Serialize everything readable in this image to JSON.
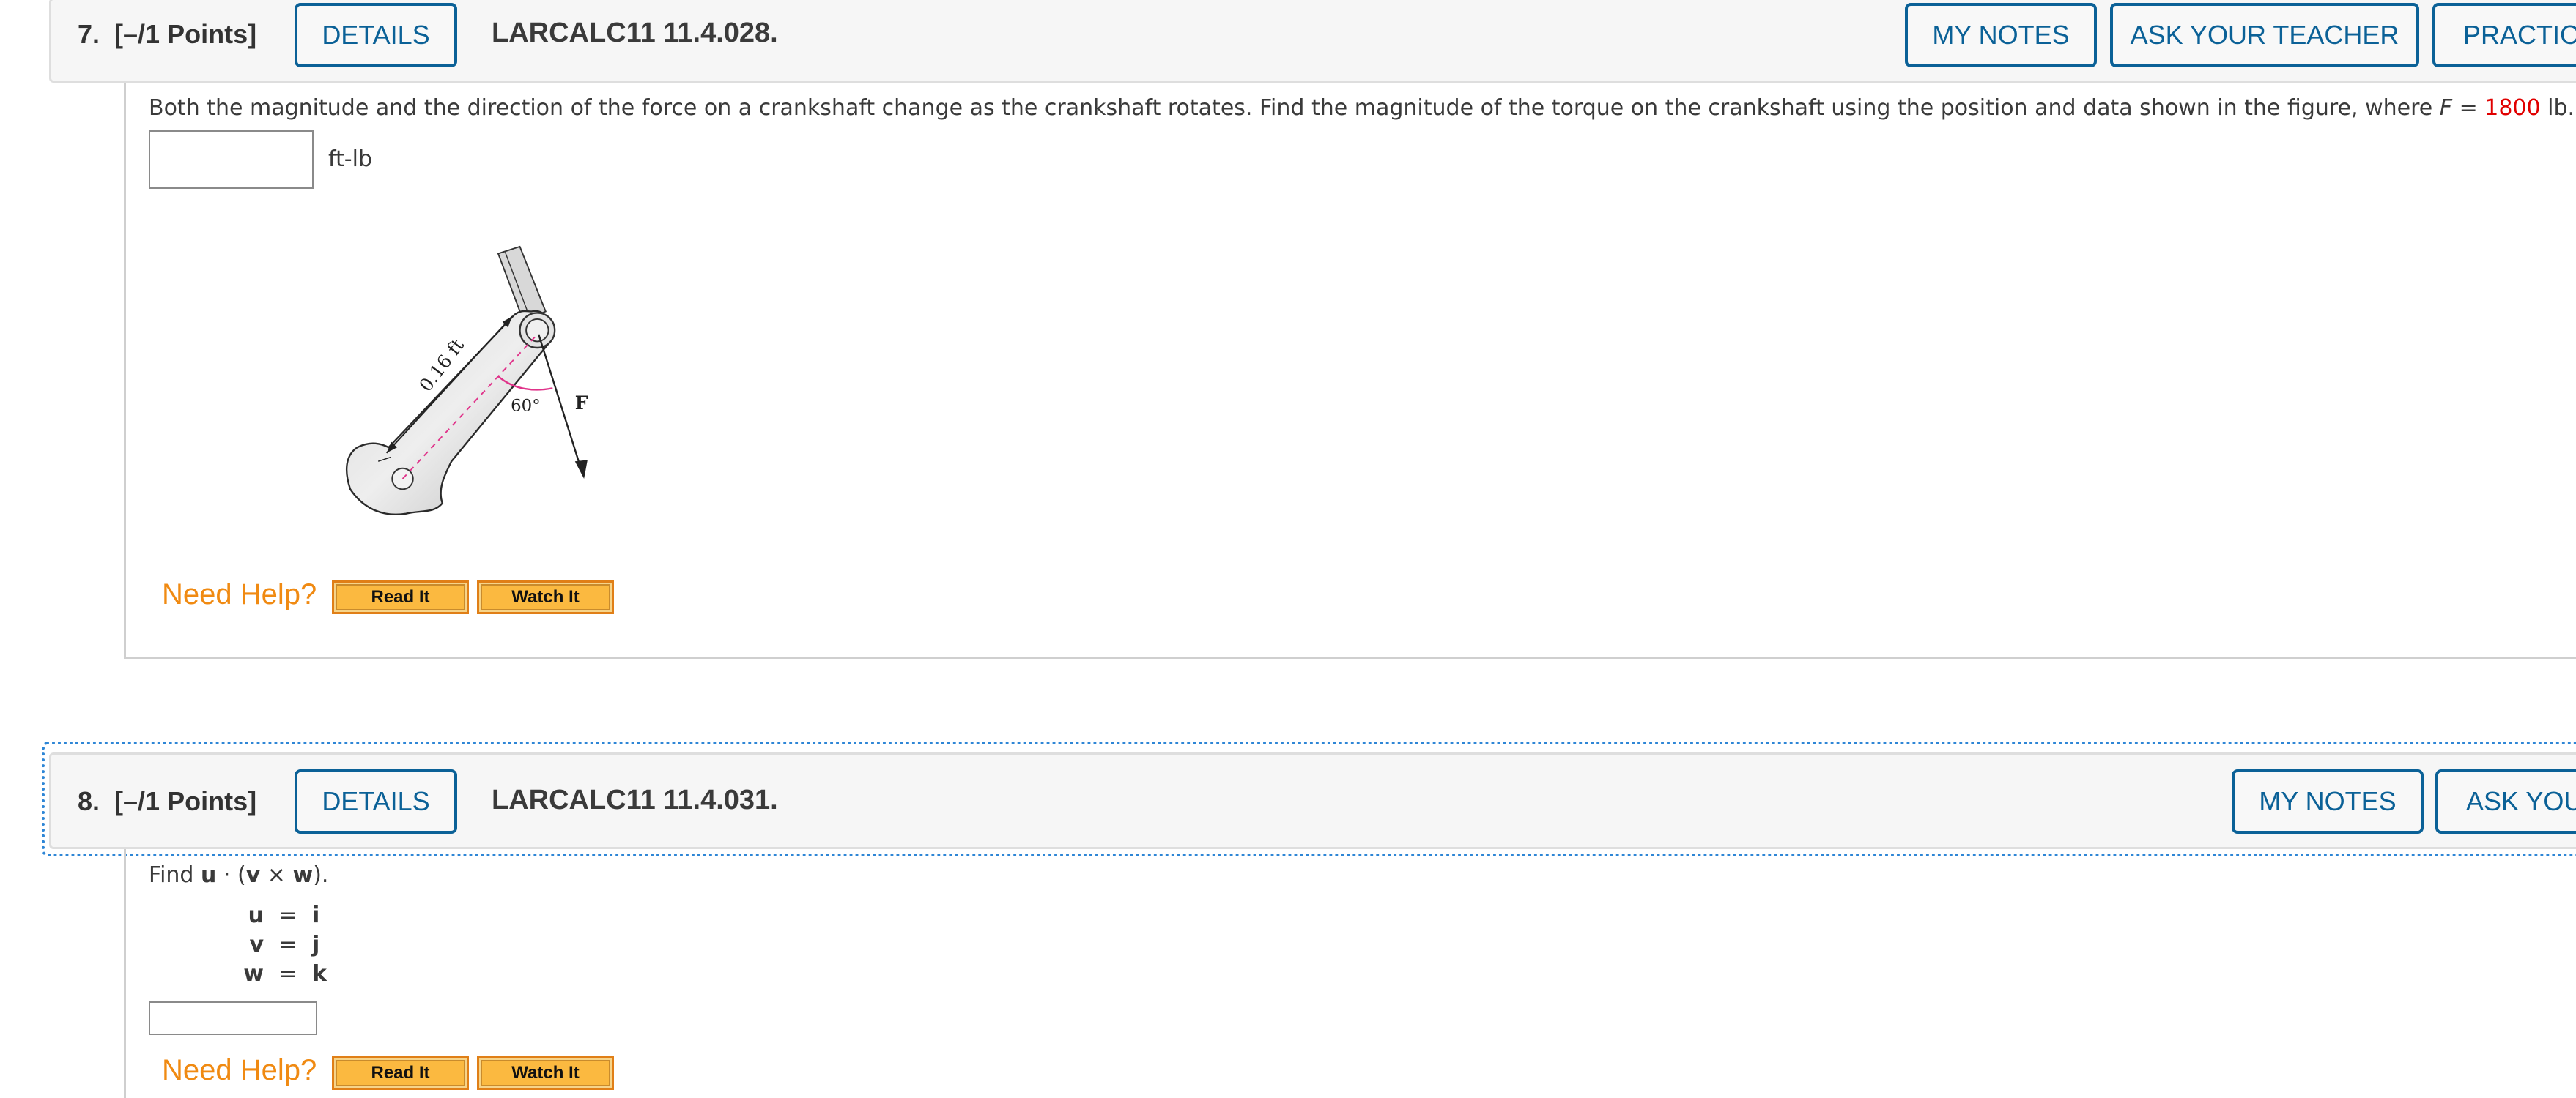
{
  "questions": [
    {
      "number": "7.",
      "points": "[–/1 Points]",
      "details_label": "DETAILS",
      "problem_id": "LARCALC11 11.4.028.",
      "buttons": [
        "MY NOTES",
        "ASK YOUR TEACHER",
        "PRACTICE"
      ],
      "prompt_before": "Both the magnitude and the direction of the force on a crankshaft change as the crankshaft rotates. Find the magnitude of the torque on the crankshaft using the position and data shown in the figure, where ",
      "prompt_var": "F",
      "prompt_eq": " = ",
      "prompt_value": "1800",
      "prompt_after": " lb.",
      "answer_value": "",
      "answer_unit": "ft-lb",
      "figure": {
        "length_label": "0.16 ft",
        "angle_label": "60°",
        "force_label": "F"
      },
      "need_help": "Need Help?",
      "help_buttons": [
        "Read It",
        "Watch It"
      ]
    },
    {
      "number": "8.",
      "points": "[–/1 Points]",
      "details_label": "DETAILS",
      "problem_id": "LARCALC11 11.4.031.",
      "buttons": [
        "MY NOTES",
        "ASK YOUR TEACHER"
      ],
      "prompt_find": "Find ",
      "prompt_expr": [
        "u",
        " · (",
        "v",
        " × ",
        "w",
        ")."
      ],
      "vectors": [
        {
          "name": "u",
          "eq": "=",
          "value": "i"
        },
        {
          "name": "v",
          "eq": "=",
          "value": "j"
        },
        {
          "name": "w",
          "eq": "=",
          "value": "k"
        }
      ],
      "answer_value": "",
      "need_help": "Need Help?",
      "help_buttons": [
        "Read It",
        "Watch It"
      ]
    }
  ],
  "colors": {
    "accent": "#0b6197",
    "highlight_value": "#e00000",
    "need_help": "#f08a12",
    "help_button": "#fbb940"
  }
}
